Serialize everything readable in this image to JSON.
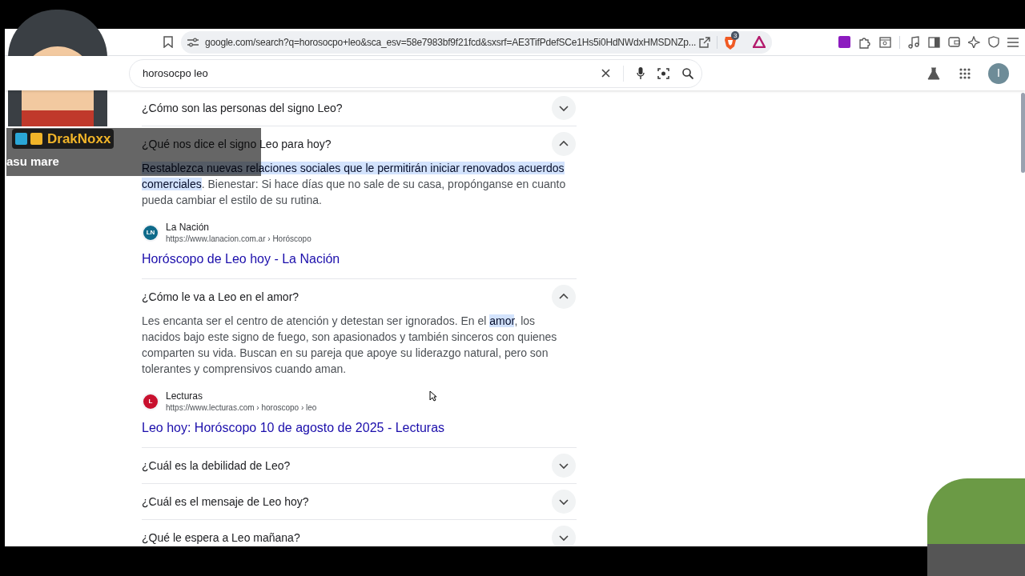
{
  "browser": {
    "url": "google.com/search?q=horosocpo+leo&sca_esv=58e7983bf9f21fcd&sxsrf=AE3TifPdefSCe1Hs5i0HdNWdxHMSDNZp...",
    "shield_count": "3"
  },
  "search": {
    "value": "horosocpo leo",
    "avatar_letter": "I"
  },
  "questions": [
    {
      "question": "¿Cómo son las personas del signo Leo?",
      "expanded": false
    },
    {
      "question": "¿Qué nos dice el signo Leo para hoy?",
      "expanded": true,
      "answer": [
        {
          "text": "Restablezca nuevas relaciones sociales que le permitirán iniciar renovados acuerdos comerciales",
          "highlighted": true
        },
        {
          "text": ". Bienestar: Si hace días que no sale de su casa, propónganse en cuanto pueda cambiar el estilo de su rutina.",
          "highlighted": false
        }
      ],
      "source": {
        "name": "La Nación",
        "url": "https://www.lanacion.com.ar › Horóscopo",
        "title": "Horóscopo de Leo hoy - La Nación",
        "logo_text": "LN",
        "color": "#0e6a8a"
      }
    },
    {
      "question": "¿Cómo le va a Leo en el amor?",
      "expanded": true,
      "answer": [
        {
          "text": "Les encanta ser el centro de atención y detestan ser ignorados. En el ",
          "highlighted": false
        },
        {
          "text": "amor",
          "highlighted": true
        },
        {
          "text": ", los nacidos bajo este signo de fuego, son apasionados y también sinceros con quienes comparten su vida. Buscan en su pareja que apoye su liderazgo natural, pero son tolerantes y comprensivos cuando aman.",
          "highlighted": false
        }
      ],
      "source": {
        "name": "Lecturas",
        "url": "https://www.lecturas.com › horoscopo › leo",
        "title": "Leo hoy: Horóscopo 10 de agosto de 2025 - Lecturas",
        "logo_text": "L",
        "color": "#c8102e"
      }
    },
    {
      "question": "¿Cuál es la debilidad de Leo?",
      "expanded": false
    },
    {
      "question": "¿Cuál es el mensaje de Leo hoy?",
      "expanded": false
    },
    {
      "question": "¿Qué le espera a Leo mañana?",
      "expanded": false
    }
  ],
  "stream_overlay": {
    "username": "DrakNoxx",
    "message": "asu mare"
  }
}
